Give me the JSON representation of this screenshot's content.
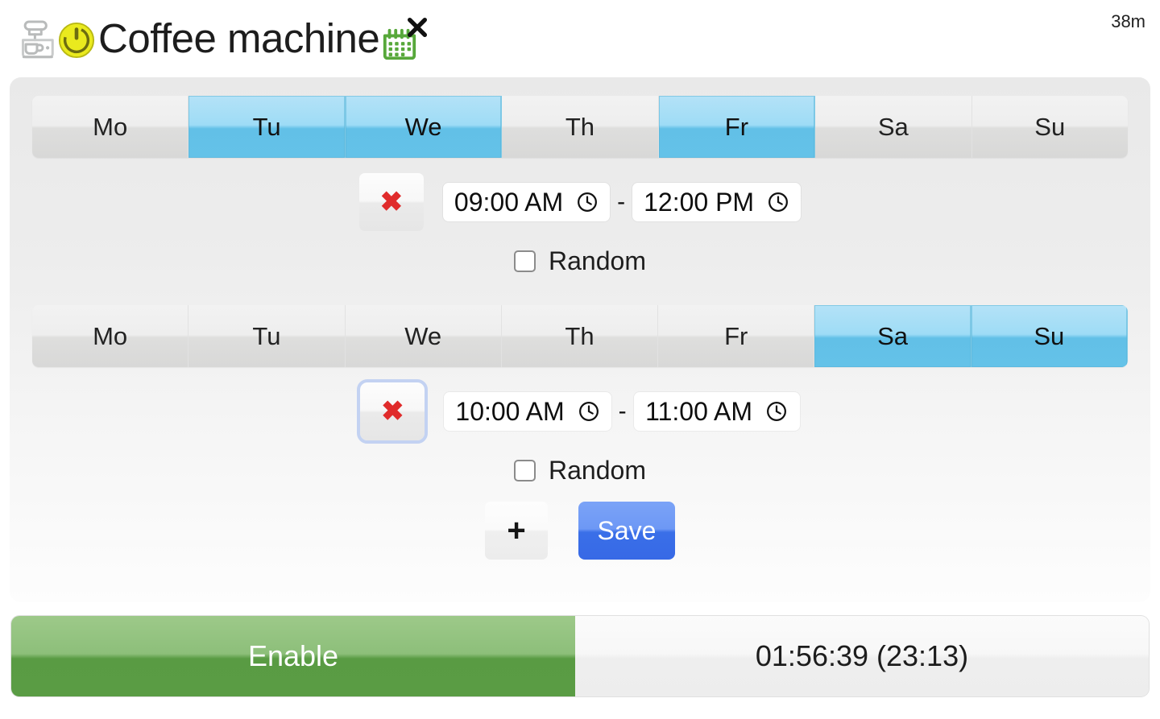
{
  "header": {
    "title": "Coffee machine",
    "coffee_icon": "coffee-machine-icon",
    "power_icon": "power-button-icon",
    "calendar_icon": "calendar-icon",
    "calendar_clear_icon": "close-x-icon",
    "uptime": "38m"
  },
  "schedules": [
    {
      "days": [
        {
          "label": "Mo",
          "selected": false
        },
        {
          "label": "Tu",
          "selected": true
        },
        {
          "label": "We",
          "selected": true
        },
        {
          "label": "Th",
          "selected": false
        },
        {
          "label": "Fr",
          "selected": true
        },
        {
          "label": "Sa",
          "selected": false
        },
        {
          "label": "Su",
          "selected": false
        }
      ],
      "delete_icon": "red-x-icon",
      "delete_focused": false,
      "start_time": "09:00 AM",
      "end_time": "12:00 PM",
      "separator": "-",
      "clock_icon": "clock-icon",
      "random_label": "Random",
      "random_checked": false
    },
    {
      "days": [
        {
          "label": "Mo",
          "selected": false
        },
        {
          "label": "Tu",
          "selected": false
        },
        {
          "label": "We",
          "selected": false
        },
        {
          "label": "Th",
          "selected": false
        },
        {
          "label": "Fr",
          "selected": false
        },
        {
          "label": "Sa",
          "selected": true
        },
        {
          "label": "Su",
          "selected": true
        }
      ],
      "delete_icon": "red-x-icon",
      "delete_focused": true,
      "start_time": "10:00 AM",
      "end_time": "11:00 AM",
      "separator": "-",
      "clock_icon": "clock-icon",
      "random_label": "Random",
      "random_checked": false
    }
  ],
  "actions": {
    "add_label": "+",
    "add_icon": "plus-icon",
    "save_label": "Save"
  },
  "footer": {
    "enable_label": "Enable",
    "countdown": "01:56:39 (23:13)"
  },
  "colors": {
    "selected_day_top": "#b4e2f7",
    "selected_day_bottom": "#62c0e7",
    "save_blue": "#3a6fe8",
    "enable_green": "#599b43",
    "delete_red": "#e02b2b",
    "calendar_green": "#5caa3c",
    "power_yellow": "#e8e82a"
  }
}
